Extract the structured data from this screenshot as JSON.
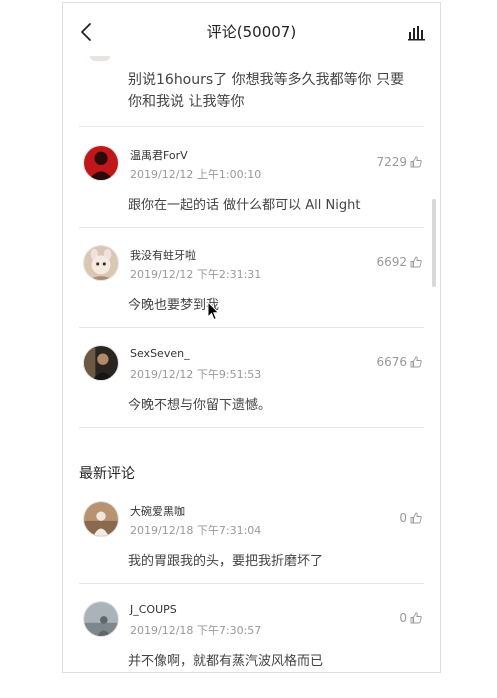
{
  "header": {
    "title": "评论(50007)",
    "back_icon": "back-arrow-icon",
    "right_icon": "bar-chart-icon"
  },
  "first_comment_tail": {
    "text": "别说16hours了 你想我等多久我都等你 只要你和我说 让我等你"
  },
  "hot_comments": [
    {
      "name": "温禹君ForV",
      "time": "2019/12/12 上午1:00:10",
      "likes": "7229",
      "text": "跟你在一起的话 做什么都可以 All Night"
    },
    {
      "name": "我没有蛀牙啦",
      "time": "2019/12/12 下午2:31:31",
      "likes": "6692",
      "text": "今晚也要梦到我"
    },
    {
      "name": "SexSeven_",
      "time": "2019/12/12 下午9:51:53",
      "likes": "6676",
      "text": "今晚不想与你留下遗憾。"
    }
  ],
  "latest_section": {
    "title": "最新评论"
  },
  "latest_comments": [
    {
      "name": "大碗爱黑咖",
      "time": "2019/12/18 下午7:31:04",
      "likes": "0",
      "text": "我的胃跟我的头，要把我折磨坏了"
    },
    {
      "name": "J_COUPS",
      "time": "2019/12/18 下午7:30:57",
      "likes": "0",
      "text": "并不像啊，就都有蒸汽波风格而已"
    }
  ],
  "colors": {
    "text": "#444444",
    "secondary": "#999999",
    "divider": "#e7e7e7"
  }
}
